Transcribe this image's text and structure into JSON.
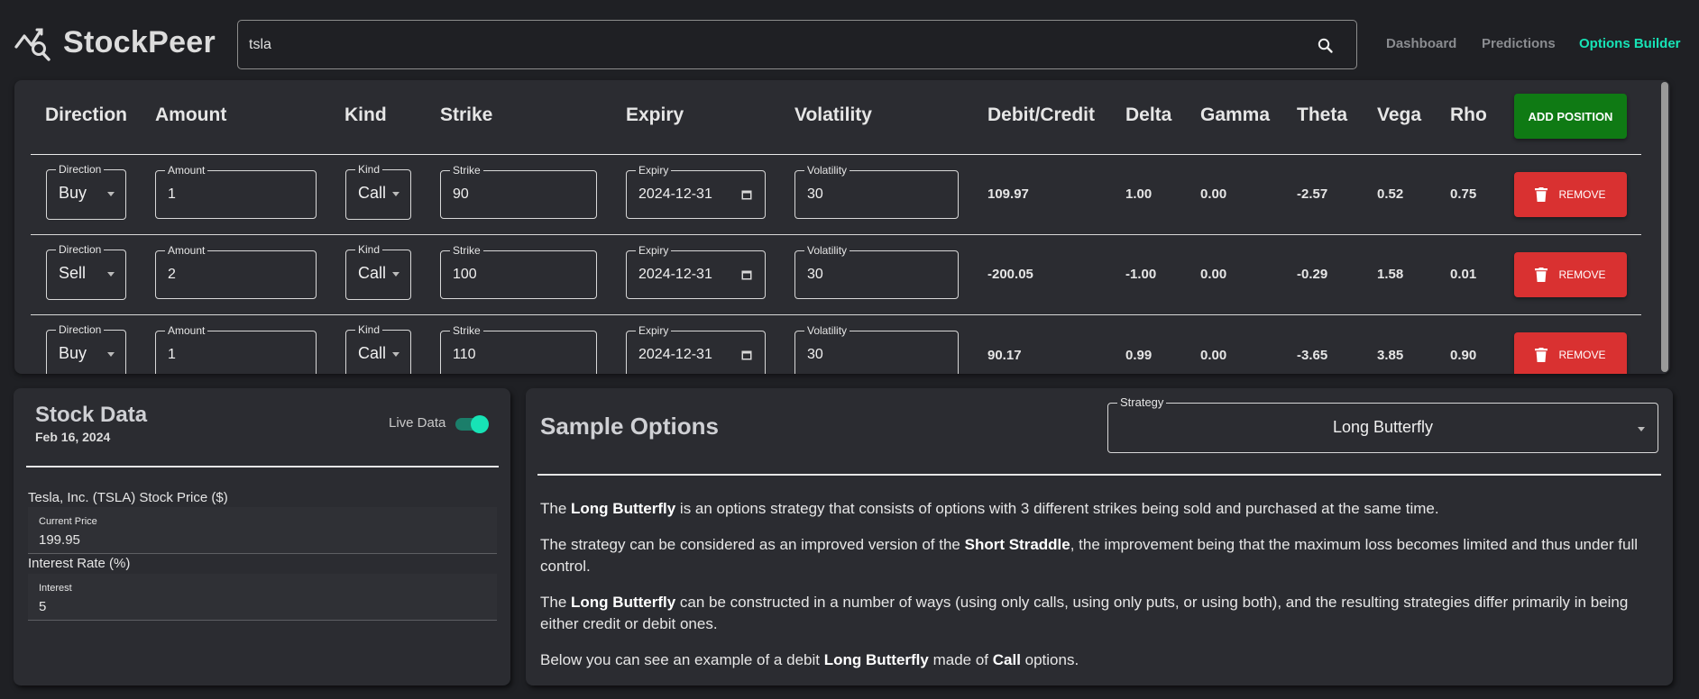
{
  "app": {
    "name": "StockPeer",
    "search": {
      "value": "tsla",
      "placeholder": ""
    },
    "nav": [
      {
        "label": "Dashboard",
        "active": false
      },
      {
        "label": "Predictions",
        "active": false
      },
      {
        "label": "Options Builder",
        "active": true
      }
    ]
  },
  "positions": {
    "columns": [
      "Direction",
      "Amount",
      "Kind",
      "Strike",
      "Expiry",
      "Volatility",
      "Debit/Credit",
      "Delta",
      "Gamma",
      "Theta",
      "Vega",
      "Rho"
    ],
    "add_label": "ADD POSITION",
    "remove_label": "REMOVE",
    "field_labels": {
      "direction": "Direction",
      "amount": "Amount",
      "kind": "Kind",
      "strike": "Strike",
      "expiry": "Expiry",
      "volatility": "Volatility"
    },
    "rows": [
      {
        "direction": "Buy",
        "amount": "1",
        "kind": "Call",
        "strike": "90",
        "expiry": "2024-12-31",
        "volatility": "30",
        "debit_credit": "109.97",
        "delta": "1.00",
        "gamma": "0.00",
        "theta": "-2.57",
        "vega": "0.52",
        "rho": "0.75"
      },
      {
        "direction": "Sell",
        "amount": "2",
        "kind": "Call",
        "strike": "100",
        "expiry": "2024-12-31",
        "volatility": "30",
        "debit_credit": "-200.05",
        "delta": "-1.00",
        "gamma": "0.00",
        "theta": "-0.29",
        "vega": "1.58",
        "rho": "0.01"
      },
      {
        "direction": "Buy",
        "amount": "1",
        "kind": "Call",
        "strike": "110",
        "expiry": "2024-12-31",
        "volatility": "30",
        "debit_credit": "90.17",
        "delta": "0.99",
        "gamma": "0.00",
        "theta": "-3.65",
        "vega": "3.85",
        "rho": "0.90"
      }
    ]
  },
  "stock_data": {
    "title": "Stock Data",
    "date": "Feb 16, 2024",
    "live_label": "Live Data",
    "live_on": true,
    "price_section": "Tesla, Inc. (TSLA) Stock Price ($)",
    "current_price_label": "Current Price",
    "current_price": "199.95",
    "interest_section": "Interest Rate (%)",
    "interest_label": "Interest",
    "interest": "5"
  },
  "sample_options": {
    "title": "Sample Options",
    "strategy_label": "Strategy",
    "strategy": "Long Butterfly",
    "p1": {
      "a": "The ",
      "b1": "Long Butterfly",
      "c": " is an options strategy that consists of options with 3 different strikes being sold and purchased at the same time."
    },
    "p2": {
      "a": "The strategy can be considered as an improved version of the ",
      "b1": "Short Straddle",
      "c": ", the improvement being that the maximum loss becomes limited and thus under full control."
    },
    "p3": {
      "a": "The ",
      "b1": "Long Butterfly",
      "c": " can be constructed in a number of ways (using only calls, using only puts, or using both), and the resulting strategies differ primarily in being either credit or debit ones."
    },
    "p4": {
      "a": "Below you can see an example of a debit ",
      "b1": "Long Butterfly",
      "c": " made of ",
      "b2": "Call",
      "d": " options."
    }
  },
  "colors": {
    "accent": "#17e3b6",
    "add_button": "#0f7a14",
    "remove_button": "#d93131",
    "panel": "#2b2c31",
    "background": "#1f2024"
  },
  "icons": [
    "logo-icon",
    "search-icon",
    "chevron-down-icon",
    "calendar-icon",
    "trash-icon"
  ]
}
